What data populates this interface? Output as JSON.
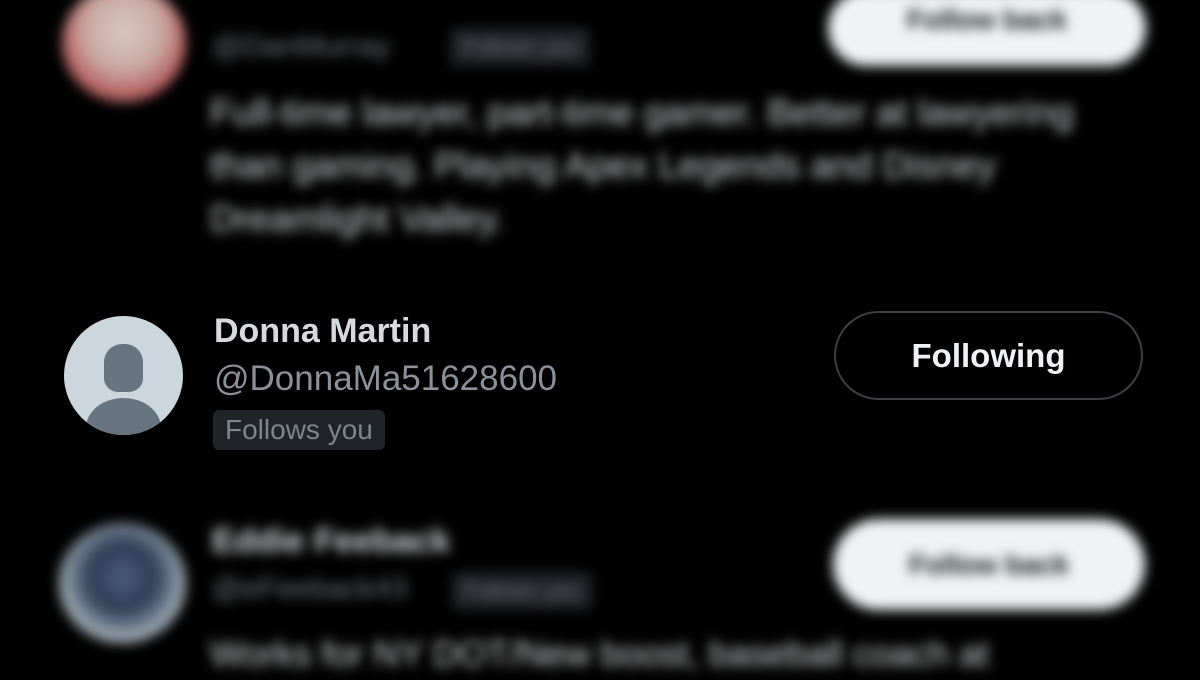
{
  "rows": [
    {
      "handle": "@DanMurray",
      "badge": "Follows you",
      "button": "Follow back",
      "bio": "Full-time lawyer, part-time gamer. Better at lawyering than gaming. Playing Apex Legends and Disney Dreamlight Valley."
    },
    {
      "name": "Donna Martin",
      "handle": "@DonnaMa51628600",
      "badge": "Follows you",
      "button": "Following"
    },
    {
      "name": "Eddie Feeback",
      "handle": "@eFeeback43",
      "badge": "Follows you",
      "button": "Follow back",
      "bio": "Works for NY DOT/New boost, baseball coach at"
    }
  ]
}
